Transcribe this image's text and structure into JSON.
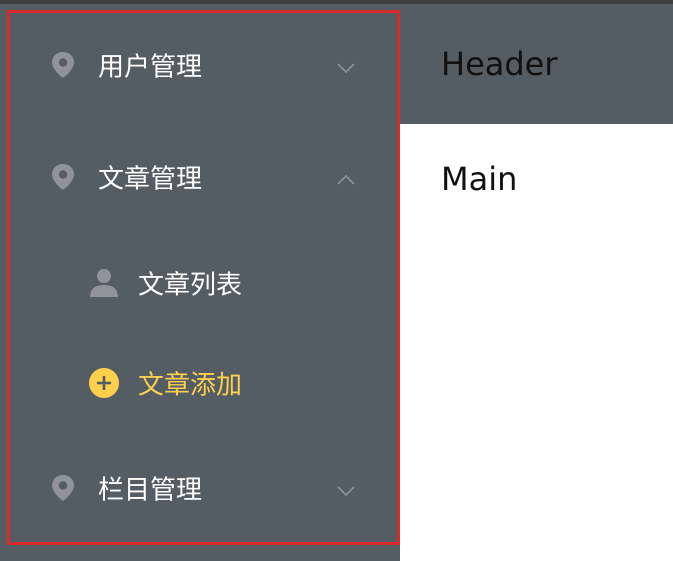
{
  "sidebar": {
    "menus": [
      {
        "label": "用户管理",
        "icon": "location-pin-icon",
        "expanded": false
      },
      {
        "label": "文章管理",
        "icon": "location-pin-icon",
        "expanded": true,
        "children": [
          {
            "label": "文章列表",
            "icon": "user-icon",
            "active": false
          },
          {
            "label": "文章添加",
            "icon": "add-circle-icon",
            "active": true
          }
        ]
      },
      {
        "label": "栏目管理",
        "icon": "location-pin-icon",
        "expanded": false
      }
    ],
    "colors": {
      "background": "#545c64",
      "text": "#ffffff",
      "active_text": "#ffd04b",
      "highlight_border": "#d62b2b"
    }
  },
  "header": {
    "title": "Header"
  },
  "main": {
    "title": "Main"
  }
}
